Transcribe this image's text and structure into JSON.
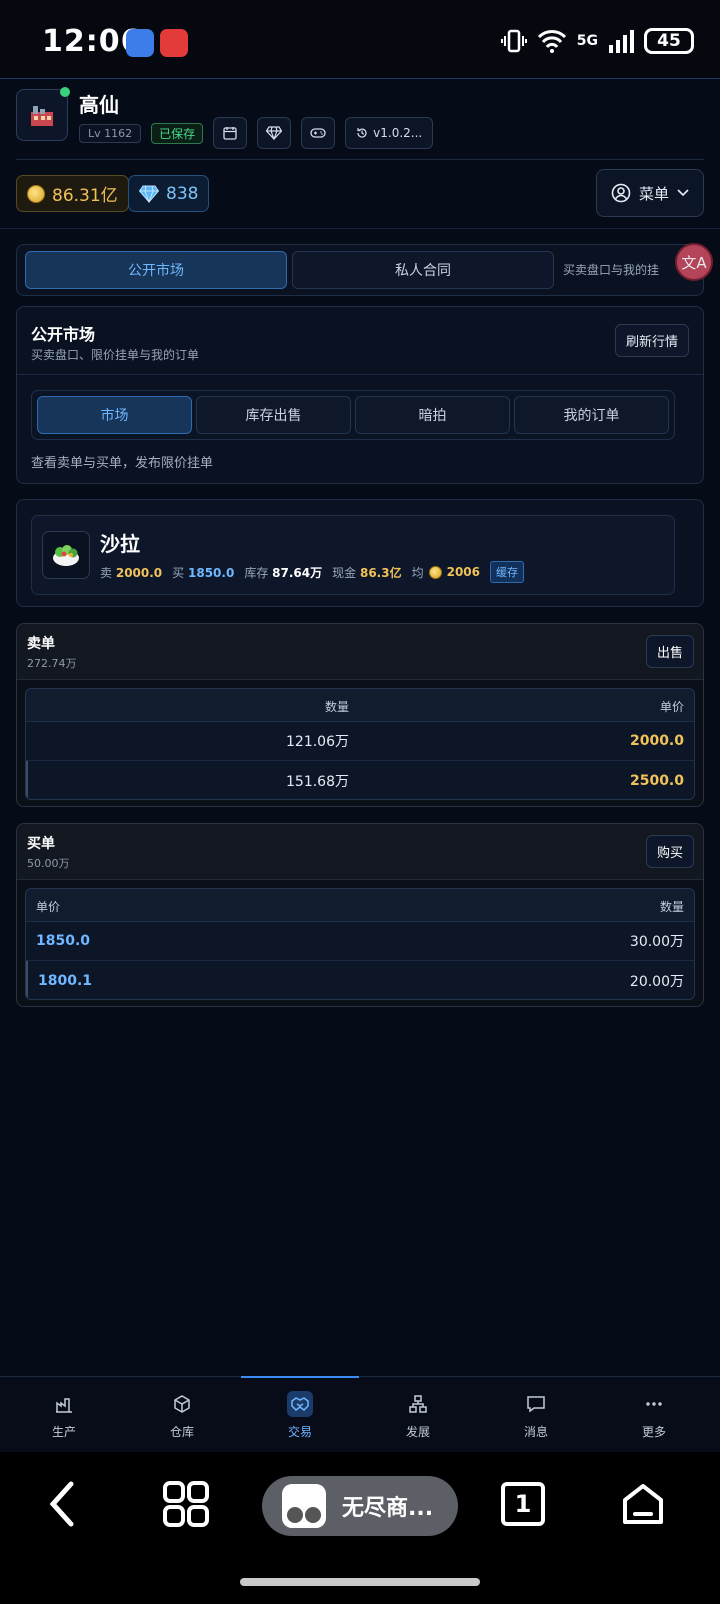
{
  "status_bar": {
    "time": "12:06",
    "network": "5G",
    "battery": "45"
  },
  "header": {
    "username": "高仙",
    "level": "Lv 1162",
    "saved_badge": "已保存",
    "version": "v1.0.2...",
    "gold": "86.31亿",
    "gems": "838",
    "menu_label": "菜单"
  },
  "top_tabs": {
    "items": [
      {
        "label": "公开市场",
        "active": true
      },
      {
        "label": "私人合同",
        "active": false
      }
    ],
    "hint": "买卖盘口与我的挂"
  },
  "translate_fab": "文A",
  "market_card": {
    "title": "公开市场",
    "subtitle": "买卖盘口、限价挂单与我的订单",
    "refresh_label": "刷新行情",
    "subtabs": [
      {
        "label": "市场",
        "active": true
      },
      {
        "label": "库存出售",
        "active": false
      },
      {
        "label": "暗拍",
        "active": false
      },
      {
        "label": "我的订单",
        "active": false
      }
    ],
    "hint": "查看卖单与买单，发布限价挂单"
  },
  "item": {
    "name": "沙拉",
    "icon": "salad-icon",
    "sell_label": "卖",
    "sell_value": "2000.0",
    "buy_label": "买",
    "buy_value": "1850.0",
    "stock_label": "库存",
    "stock_value": "87.64万",
    "cash_label": "现金",
    "cash_value": "86.3亿",
    "avg_label": "均",
    "avg_value": "2006",
    "cache_badge": "缓存"
  },
  "sell_book": {
    "title": "卖单",
    "total": "272.74万",
    "action_label": "出售",
    "col_qty": "数量",
    "col_price": "单价",
    "rows": [
      {
        "qty": "121.06万",
        "price": "2000.0"
      },
      {
        "qty": "151.68万",
        "price": "2500.0"
      }
    ]
  },
  "buy_book": {
    "title": "买单",
    "total": "50.00万",
    "action_label": "购买",
    "col_price": "单价",
    "col_qty": "数量",
    "rows": [
      {
        "price": "1850.0",
        "qty": "30.00万"
      },
      {
        "price": "1800.1",
        "qty": "20.00万"
      }
    ]
  },
  "bottom_nav": {
    "items": [
      {
        "label": "生产",
        "icon": "factory-chart-icon"
      },
      {
        "label": "仓库",
        "icon": "box-icon"
      },
      {
        "label": "交易",
        "icon": "handshake-icon",
        "active": true
      },
      {
        "label": "发展",
        "icon": "org-tree-icon"
      },
      {
        "label": "消息",
        "icon": "chat-bubble-icon"
      },
      {
        "label": "更多",
        "icon": "more-dots-icon"
      }
    ]
  },
  "system_nav": {
    "app_label": "无尽商...",
    "tab_count": "1"
  },
  "colors": {
    "background": "#060b18",
    "accent_blue": "#6fb7ff",
    "gold": "#f1c258",
    "saved_green": "#4ad98a"
  }
}
